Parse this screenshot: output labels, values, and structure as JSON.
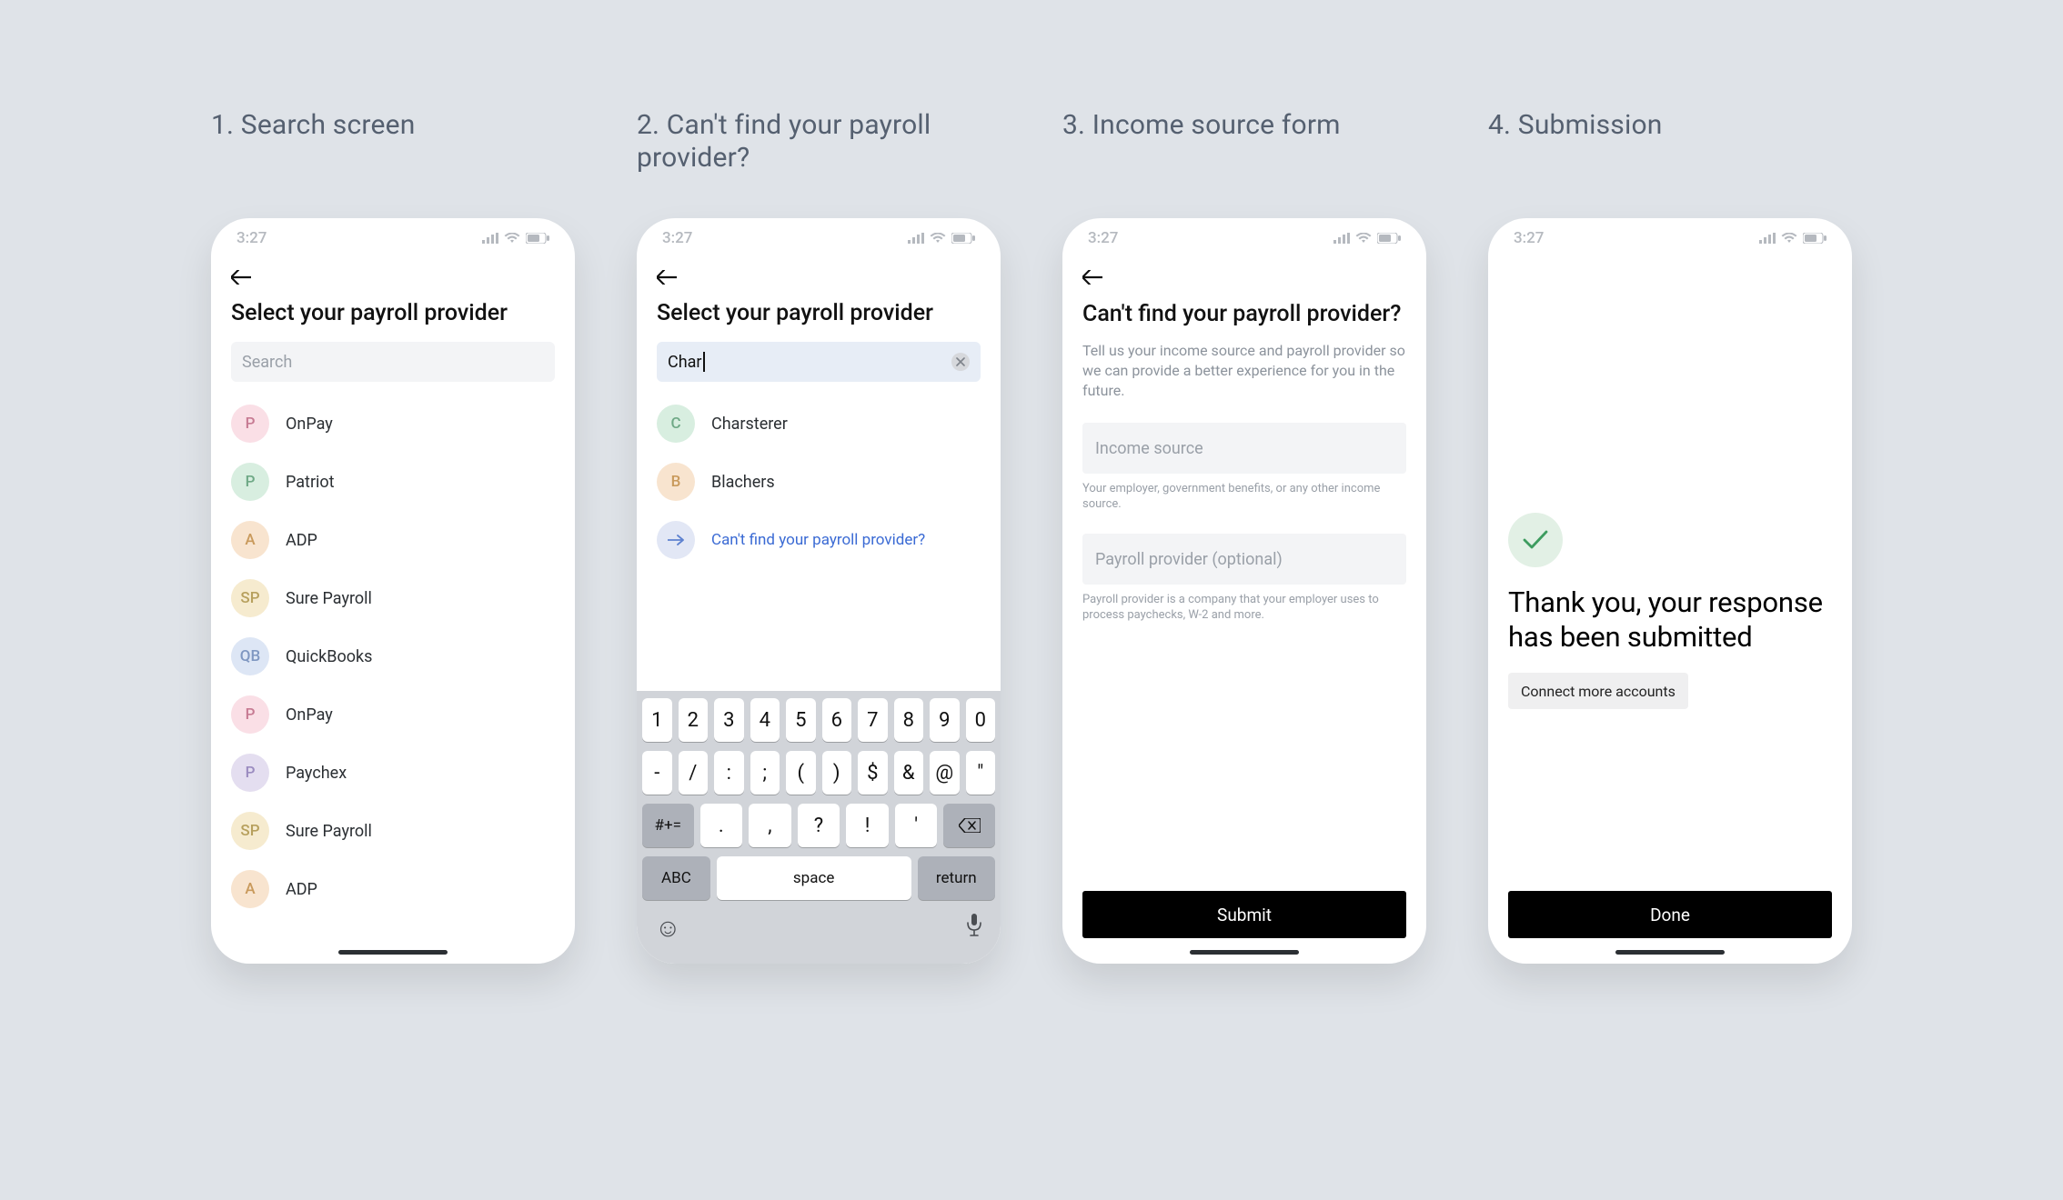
{
  "titles": {
    "c1": "1. Search screen",
    "c2": "2. Can't find your payroll provider?",
    "c3": "3. Income source form",
    "c4": "4. Submission"
  },
  "status_time": "3:27",
  "screen1": {
    "title": "Select your payroll provider",
    "search_placeholder": "Search",
    "items": [
      {
        "initial": "P",
        "label": "OnPay",
        "bg": "#fadfe6",
        "fg": "#c77b93"
      },
      {
        "initial": "P",
        "label": "Patriot",
        "bg": "#d8eee0",
        "fg": "#6fa986"
      },
      {
        "initial": "A",
        "label": "ADP",
        "bg": "#f8e4cf",
        "fg": "#c99a5c"
      },
      {
        "initial": "SP",
        "label": "Sure Payroll",
        "bg": "#f6ebcf",
        "fg": "#b7a05d"
      },
      {
        "initial": "QB",
        "label": "QuickBooks",
        "bg": "#dde6f5",
        "fg": "#7f97c1"
      },
      {
        "initial": "P",
        "label": "OnPay",
        "bg": "#fadfe6",
        "fg": "#c77b93"
      },
      {
        "initial": "P",
        "label": "Paychex",
        "bg": "#e4def0",
        "fg": "#9b8cc0"
      },
      {
        "initial": "SP",
        "label": "Sure Payroll",
        "bg": "#f6ebcf",
        "fg": "#b7a05d"
      },
      {
        "initial": "A",
        "label": "ADP",
        "bg": "#f8e4cf",
        "fg": "#c99a5c"
      }
    ]
  },
  "screen2": {
    "title": "Select your payroll provider",
    "search_value": "Char",
    "items": [
      {
        "initial": "C",
        "label": "Charsterer",
        "bg": "#d8eee0",
        "fg": "#6fa986"
      },
      {
        "initial": "B",
        "label": "Blachers",
        "bg": "#f8e4cf",
        "fg": "#c99a5c"
      }
    ],
    "cant_find_label": "Can't find your payroll provider?",
    "keyboard": {
      "row1": [
        "1",
        "2",
        "3",
        "4",
        "5",
        "6",
        "7",
        "8",
        "9",
        "0"
      ],
      "row2": [
        "-",
        "/",
        ":",
        ";",
        "(",
        ")",
        "$",
        "&",
        "@",
        "\""
      ],
      "row3_sym": "#+=",
      "row3_mid": [
        ".",
        ",",
        "?",
        "!",
        "'"
      ],
      "row4_abc": "ABC",
      "row4_space": "space",
      "row4_return": "return"
    }
  },
  "screen3": {
    "title": "Can't find your payroll provider?",
    "subtitle": "Tell us your income source and payroll provider so we can provide a better experience for you in the future.",
    "income_placeholder": "Income source",
    "income_helper": "Your employer, government benefits, or any other income source.",
    "provider_placeholder": "Payroll provider (optional)",
    "provider_helper": "Payroll provider is a company that your employer uses to process paychecks, W-2 and more.",
    "submit": "Submit"
  },
  "screen4": {
    "thanks": "Thank you, your response has been submitted",
    "chip": "Connect more accounts",
    "done": "Done"
  }
}
